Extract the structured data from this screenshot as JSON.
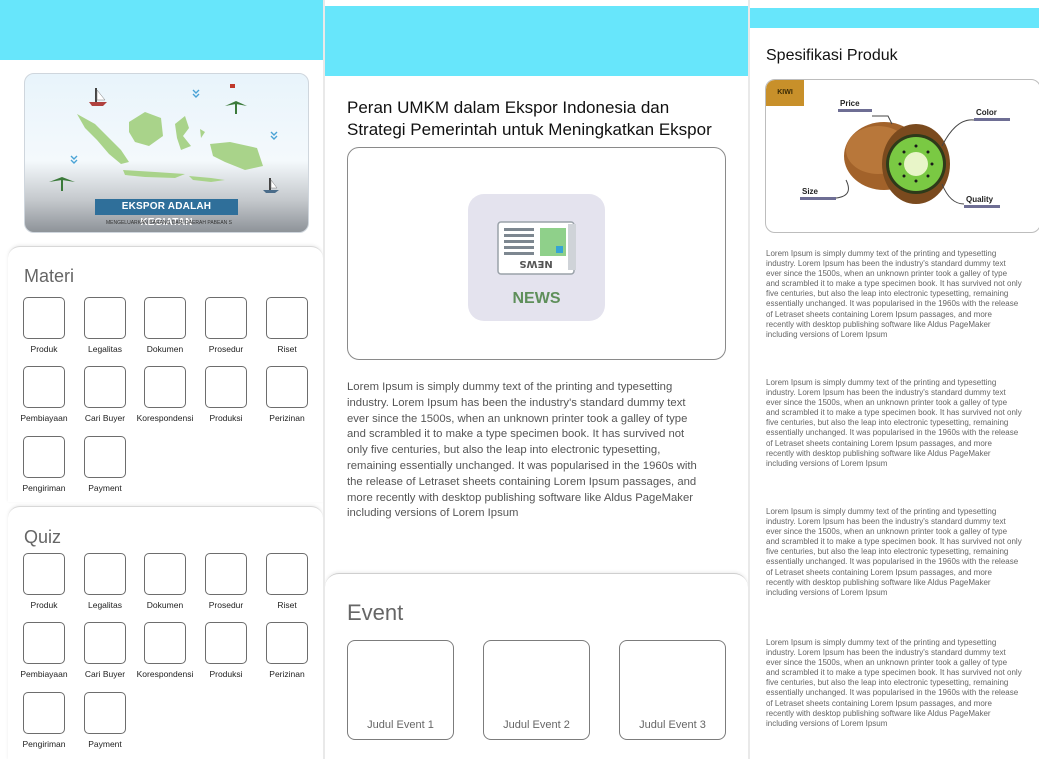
{
  "panel1": {
    "banner": {
      "title": "EKSPOR ADALAH KEGIATAN",
      "subtitle": "MENGELUARKAN BARANG DARI DAERAH PABEAN S"
    },
    "materi": {
      "title": "Materi",
      "items": [
        "Produk",
        "Legalitas",
        "Dokumen",
        "Prosedur",
        "Riset",
        "Pembiayaan",
        "Cari Buyer",
        "Korespondensi",
        "Produksi",
        "Perizinan",
        "Pengiriman",
        "Payment"
      ]
    },
    "quiz": {
      "title": "Quiz",
      "items": [
        "Produk",
        "Legalitas",
        "Dokumen",
        "Prosedur",
        "Riset",
        "Pembiayaan",
        "Cari Buyer",
        "Korespondensi",
        "Produksi",
        "Perizinan",
        "Pengiriman",
        "Payment"
      ]
    }
  },
  "panel2": {
    "article_title": "Peran UMKM dalam Ekspor Indonesia dan Strategi Pemerintah untuk Meningkatkan Ekspor",
    "news_label": "NEWS",
    "body": "Lorem Ipsum is simply dummy text of the printing and typesetting industry. Lorem Ipsum has been the industry's standard dummy text ever since the 1500s, when an unknown printer took a galley of type and scrambled it to make a type specimen book. It has survived not only five centuries, but also the leap into electronic typesetting, remaining essentially unchanged. It was popularised in the 1960s with the release of Letraset sheets containing Lorem Ipsum passages, and more recently with desktop publishing software like Aldus PageMaker including versions of Lorem Ipsum",
    "event": {
      "title": "Event",
      "items": [
        "Judul Event 1",
        "Judul Event 2",
        "Judul Event 3"
      ]
    }
  },
  "panel3": {
    "title": "Spesifikasi Produk",
    "image": {
      "tag": "KIWI",
      "labels": {
        "price": "Price",
        "color": "Color",
        "size": "Size",
        "quality": "Quality"
      }
    },
    "paragraphs": [
      "Lorem Ipsum is simply dummy text of the printing and typesetting industry. Lorem Ipsum has been the industry's standard dummy text ever since the 1500s, when an unknown printer took a galley of type and scrambled it to make a type specimen book. It has survived not only five centuries, but also the leap into electronic typesetting, remaining essentially unchanged. It was popularised in the 1960s with the release of Letraset sheets containing Lorem Ipsum passages, and more recently with desktop publishing software like Aldus PageMaker including versions of Lorem Ipsum",
      "Lorem Ipsum is simply dummy text of the printing and typesetting industry. Lorem Ipsum has been the industry's standard dummy text ever since the 1500s, when an unknown printer took a galley of type and scrambled it to make a type specimen book. It has survived not only five centuries, but also the leap into electronic typesetting, remaining essentially unchanged. It was popularised in the 1960s with the release of Letraset sheets containing Lorem Ipsum passages, and more recently with desktop publishing software like Aldus PageMaker including versions of Lorem Ipsum",
      "Lorem Ipsum is simply dummy text of the printing and typesetting industry. Lorem Ipsum has been the industry's standard dummy text ever since the 1500s, when an unknown printer took a galley of type and scrambled it to make a type specimen book. It has survived not only five centuries, but also the leap into electronic typesetting, remaining essentially unchanged. It was popularised in the 1960s with the release of Letraset sheets containing Lorem Ipsum passages, and more recently with desktop publishing software like Aldus PageMaker including versions of Lorem Ipsum",
      "Lorem Ipsum is simply dummy text of the printing and typesetting industry. Lorem Ipsum has been the industry's standard dummy text ever since the 1500s, when an unknown printer took a galley of type and scrambled it to make a type specimen book. It has survived not only five centuries, but also the leap into electronic typesetting, remaining essentially unchanged. It was popularised in the 1960s with the release of Letraset sheets containing Lorem Ipsum passages, and more recently with desktop publishing software like Aldus PageMaker including versions of Lorem Ipsum"
    ]
  },
  "colors": {
    "topbar": "#67e6fb",
    "banner_pill": "#2f6f9a",
    "news_green": "#5e8f5a",
    "kiwi_tag": "#c8902a"
  }
}
